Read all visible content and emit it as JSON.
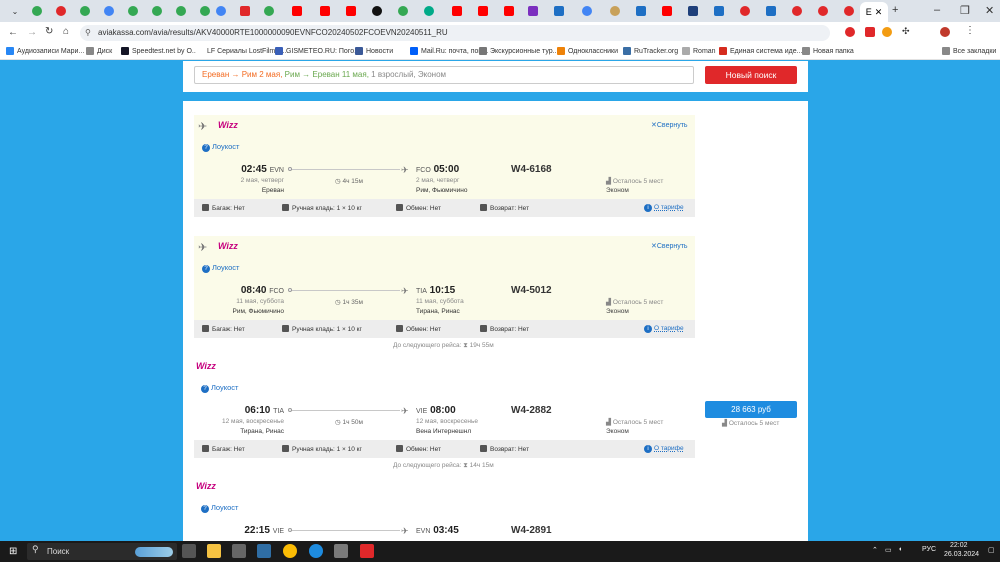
{
  "browser": {
    "url": "aviakassa.com/avia/results/AKV40000RTE1000000090EVNFCO20240502FCOEVN20240511_RU",
    "bookmarks": [
      {
        "label": "Аудиозаписи Мари...",
        "color": "#2787f5"
      },
      {
        "label": "Диск",
        "color": "#888"
      },
      {
        "label": "Speedtest.net by O...",
        "color": "#141526"
      },
      {
        "label": "LF Сериалы LostFilm с...",
        "color": "#ffffff"
      },
      {
        "label": "GISMETEO.RU: Пого...",
        "color": "#3a5fb8"
      },
      {
        "label": "Новости",
        "color": "#3b5998"
      },
      {
        "label": "Mail.Ru: почта, пои...",
        "color": "#005ff9"
      },
      {
        "label": "Экскурсионные тур...",
        "color": "#777"
      },
      {
        "label": "Одноклассники",
        "color": "#ee8208"
      },
      {
        "label": "RuTracker.org",
        "color": "#3a6ea5"
      },
      {
        "label": "Roman",
        "color": "#aaa"
      },
      {
        "label": "Единая система иде...",
        "color": "#d52b1e"
      },
      {
        "label": "Новая папка",
        "color": "#888"
      },
      {
        "label": "Все закладки",
        "color": "#888"
      }
    ],
    "tabs_active_label": "E",
    "new_tab": "+"
  },
  "search": {
    "route1": "Ереван → Рим 2 мая,",
    "route2": "Рим → Ереван 11 мая,",
    "details": "1 взрослый, Эконом",
    "new_search_label": "Новый поиск"
  },
  "segments": [
    {
      "airline": "Wizz",
      "lowcost": "Лоукост",
      "collapse": "Свернуть",
      "dep_time": "02:45",
      "dep_code": "EVN",
      "dep_date": "2 мая, четверг",
      "dep_city": "Ереван",
      "duration": "4ч 15м",
      "arr_code": "FCO",
      "arr_time": "05:00",
      "arr_date": "2 мая, четверг",
      "arr_city": "Рим, Фьюмичино",
      "flight": "W4-6168",
      "seats": "Осталось 5 мест",
      "class": "Эконом",
      "baggage": "Багаж: Нет",
      "carry_on": "Ручная кладь: 1 × 10 кг",
      "exchange": "Обмен: Нет",
      "refund": "Возврат: Нет",
      "fare": "О тарифе"
    },
    {
      "airline": "Wizz",
      "lowcost": "Лоукост",
      "collapse": "Свернуть",
      "dep_time": "08:40",
      "dep_code": "FCO",
      "dep_date": "11 мая, суббота",
      "dep_city": "Рим, Фьюмичино",
      "duration": "1ч 35м",
      "arr_code": "TIA",
      "arr_time": "10:15",
      "arr_date": "11 мая, суббота",
      "arr_city": "Тирана, Ринас",
      "flight": "W4-5012",
      "seats": "Осталось 5 мест",
      "class": "Эконом",
      "baggage": "Багаж: Нет",
      "carry_on": "Ручная кладь: 1 × 10 кг",
      "exchange": "Обмен: Нет",
      "refund": "Возврат: Нет",
      "fare": "О тарифе",
      "layover": "До следующего рейса:",
      "layover_time": "19ч 55м"
    },
    {
      "airline": "Wizz",
      "lowcost": "Лоукост",
      "dep_time": "06:10",
      "dep_code": "TIA",
      "dep_date": "12 мая, воскресенье",
      "dep_city": "Тирана, Ринас",
      "duration": "1ч 50м",
      "arr_code": "VIE",
      "arr_time": "08:00",
      "arr_date": "12 мая, воскресенье",
      "arr_city": "Вена Интернешнл",
      "flight": "W4-2882",
      "seats": "Осталось 5 мест",
      "class": "Эконом",
      "baggage": "Багаж: Нет",
      "carry_on": "Ручная кладь: 1 × 10 кг",
      "exchange": "Обмен: Нет",
      "refund": "Возврат: Нет",
      "fare": "О тарифе",
      "layover": "До следующего рейса:",
      "layover_time": "14ч 15м"
    },
    {
      "airline": "Wizz",
      "lowcost": "Лоукост",
      "dep_time": "22:15",
      "dep_code": "VIE",
      "arr_code": "EVN",
      "arr_time": "03:45",
      "flight": "W4-2891"
    }
  ],
  "price": {
    "amount": "28 663 руб",
    "seats": "Осталось 5 мест"
  },
  "taskbar": {
    "search_placeholder": "Поиск",
    "lang": "РУС",
    "time": "22:02",
    "date": "26.03.2024"
  }
}
